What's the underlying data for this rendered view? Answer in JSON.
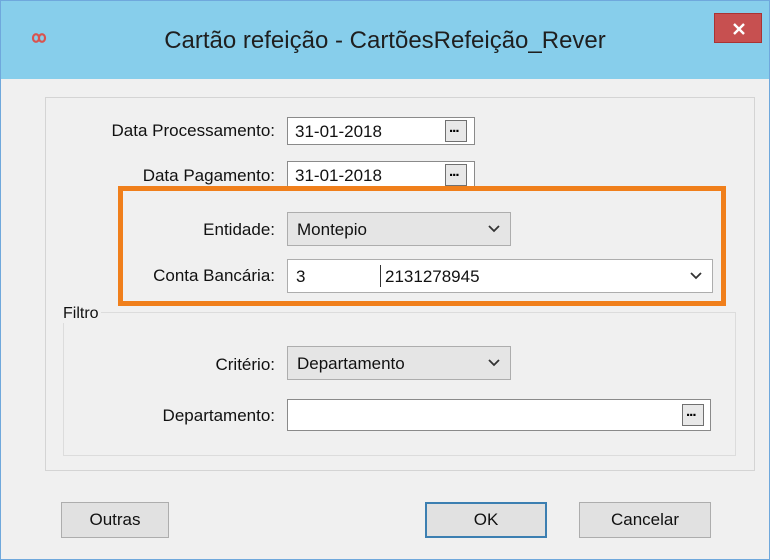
{
  "window": {
    "title": "Cartão refeição - CartõesRefeição_Rever",
    "accent_color": "#87ceeb",
    "close_color": "#c75050"
  },
  "form": {
    "data_processamento": {
      "label": "Data Processamento:",
      "value": "31-01-2018",
      "picker": "..."
    },
    "data_pagamento": {
      "label": "Data Pagamento:",
      "value": "31-01-2018",
      "picker": "..."
    },
    "entidade": {
      "label": "Entidade:",
      "value": "Montepio"
    },
    "conta_bancaria": {
      "label": "Conta Bancária:",
      "code": "3",
      "number": "2131278945"
    }
  },
  "filtro": {
    "label": "Filtro",
    "criterio": {
      "label": "Critério:",
      "value": "Departamento"
    },
    "departamento": {
      "label": "Departamento:",
      "value": "",
      "picker": "..."
    }
  },
  "buttons": {
    "outras": "Outras",
    "ok": "OK",
    "cancelar": "Cancelar"
  },
  "highlight_color": "#f07f1b"
}
